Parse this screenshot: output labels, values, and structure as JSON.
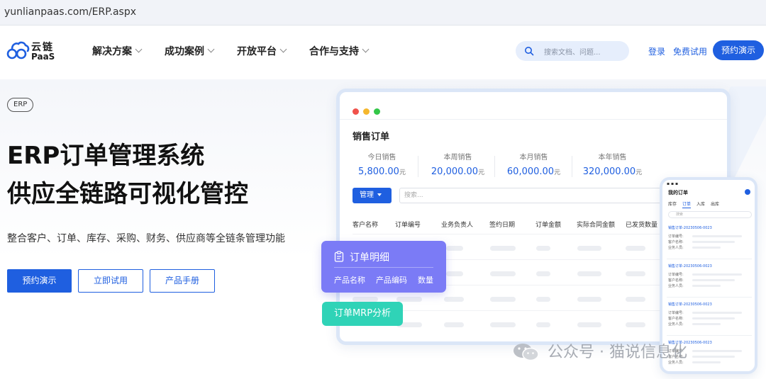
{
  "browser": {
    "url": "yunlianpaas.com/ERP.aspx"
  },
  "logo": {
    "name_cn": "云链",
    "name_en": "PaaS"
  },
  "nav": {
    "items": [
      "解决方案",
      "成功案例",
      "开放平台",
      "合作与支持"
    ],
    "search_placeholder": "搜索文档、问题...",
    "login": "登录",
    "free_trial": "免费试用",
    "book_demo": "预约演示"
  },
  "hero": {
    "tag": "ERP",
    "title_line1": "ERP订单管理系统",
    "title_line2": "供应全链路可视化管控",
    "description": "整合客户、订单、库存、采购、财务、供应商等全链条管理功能",
    "buttons": [
      "预约演示",
      "立即试用",
      "产品手册"
    ]
  },
  "window": {
    "title": "销售订单",
    "stats": [
      {
        "label": "今日销售",
        "value": "5,800.00",
        "unit": "元"
      },
      {
        "label": "本周销售",
        "value": "20,000.00",
        "unit": "元"
      },
      {
        "label": "本月销售",
        "value": "60,000.00",
        "unit": "元"
      },
      {
        "label": "本年销售",
        "value": "320,000.00",
        "unit": "元"
      }
    ],
    "manage_button": "管理",
    "search_placeholder": "搜索...",
    "columns": [
      "客户名称",
      "订单编号",
      "业务负责人",
      "签约日期",
      "订单金额",
      "实际合同金额",
      "已发货数量"
    ]
  },
  "popup_detail": {
    "title": "订单明细",
    "fields": [
      "产品名称",
      "产品编码",
      "数量"
    ]
  },
  "popup_mrp": {
    "label": "订单MRP分析"
  },
  "phone": {
    "title": "我的订单",
    "tabs": [
      "库存",
      "订单",
      "入库",
      "出库"
    ],
    "search_placeholder": "搜索",
    "cards": [
      {
        "id": "销售订单-20230506-0023"
      },
      {
        "id": "销售订单-20230506-0023"
      },
      {
        "id": "销售订单-20230506-0023"
      },
      {
        "id": "销售订单-20230506-0023"
      }
    ],
    "field_labels": [
      "订单编号:",
      "客户名称:",
      "业务人员:"
    ]
  },
  "watermark": {
    "text": "公众号 · 猫说信息化"
  },
  "colors": {
    "brand": "#1f5fe0",
    "purple": "#7b7bf6",
    "teal": "#2fd3b7"
  }
}
